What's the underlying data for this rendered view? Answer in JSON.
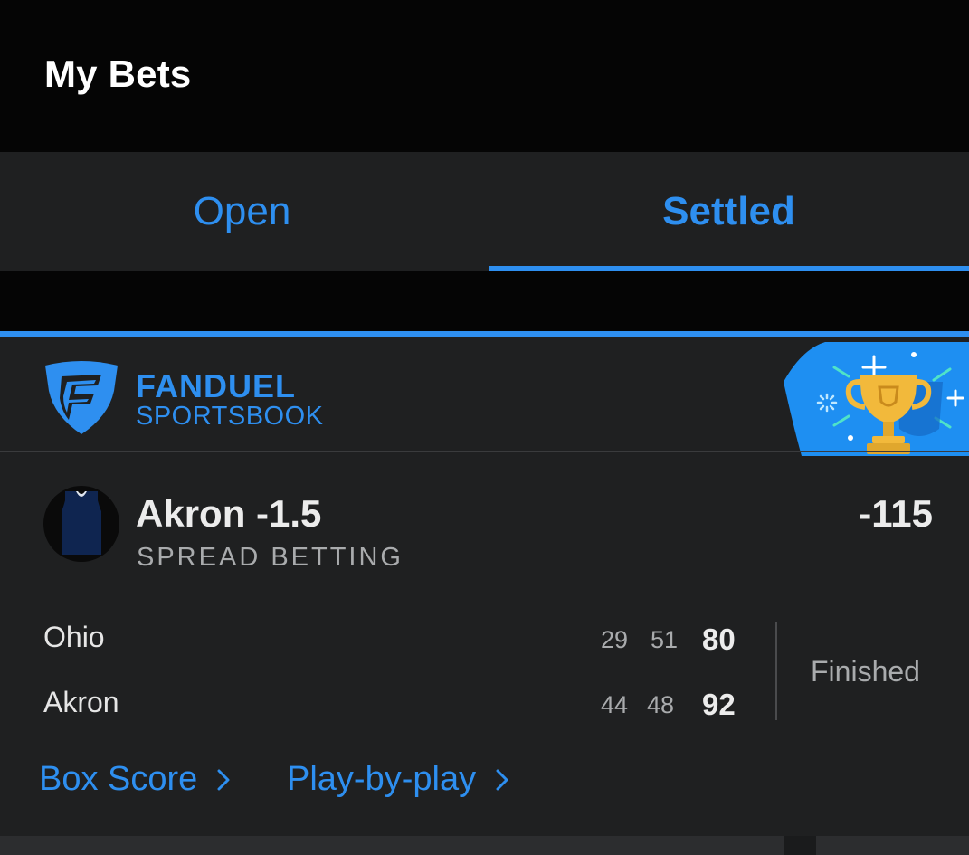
{
  "header": {
    "title": "My Bets"
  },
  "tabs": [
    {
      "label": "Open",
      "active": false
    },
    {
      "label": "Settled",
      "active": true
    }
  ],
  "card": {
    "brand": {
      "line1": "FANDUEL",
      "line2": "SPORTSBOOK",
      "logo_icon": "fanduel-shield-icon",
      "badge_icon": "trophy-icon"
    },
    "bet": {
      "selection": "Akron -1.5",
      "market": "SPREAD BETTING",
      "odds": "-115",
      "avatar_icon": "jersey-icon"
    },
    "scoreboard": {
      "teams": [
        {
          "name": "Ohio",
          "periods": [
            "29",
            "51"
          ],
          "total": "80"
        },
        {
          "name": "Akron",
          "periods": [
            "44",
            "48"
          ],
          "total": "92"
        }
      ],
      "status": "Finished"
    },
    "links": [
      {
        "label": "Box Score"
      },
      {
        "label": "Play-by-play"
      }
    ]
  },
  "colors": {
    "accent": "#2e8ff0",
    "background": "#000000",
    "surface": "#1f2021",
    "text_primary": "#ececec",
    "text_secondary": "#a9abad",
    "trophy_gold": "#f2b93b",
    "badge_blue": "#1e8ff2"
  }
}
